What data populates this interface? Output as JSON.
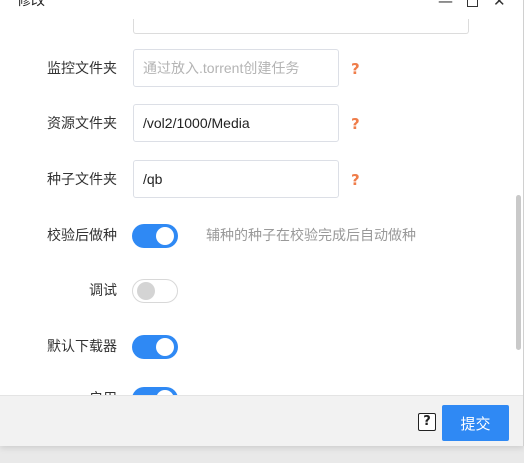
{
  "dialog": {
    "title": "修改",
    "controls": {
      "minimize": "—",
      "close": "✕"
    }
  },
  "form": {
    "monitor_folder": {
      "label": "监控文件夹",
      "value": "",
      "placeholder": "通过放入.torrent创建任务",
      "help": "?"
    },
    "resource_folder": {
      "label": "资源文件夹",
      "value": "/vol2/1000/Media",
      "help": "?"
    },
    "seed_folder": {
      "label": "种子文件夹",
      "value": "/qb",
      "help": "?"
    },
    "verify_seed": {
      "label": "校验后做种",
      "enabled": true,
      "hint": "辅种的种子在校验完成后自动做种"
    },
    "debug": {
      "label": "调试",
      "enabled": false
    },
    "default_downloader": {
      "label": "默认下载器",
      "enabled": true
    },
    "enable": {
      "label": "启用",
      "enabled": true
    }
  },
  "footer": {
    "help": "?",
    "submit_label": "提交"
  },
  "colors": {
    "accent": "#2f89f4",
    "help_icon": "#ef7d4a",
    "hint_text": "#999999"
  }
}
